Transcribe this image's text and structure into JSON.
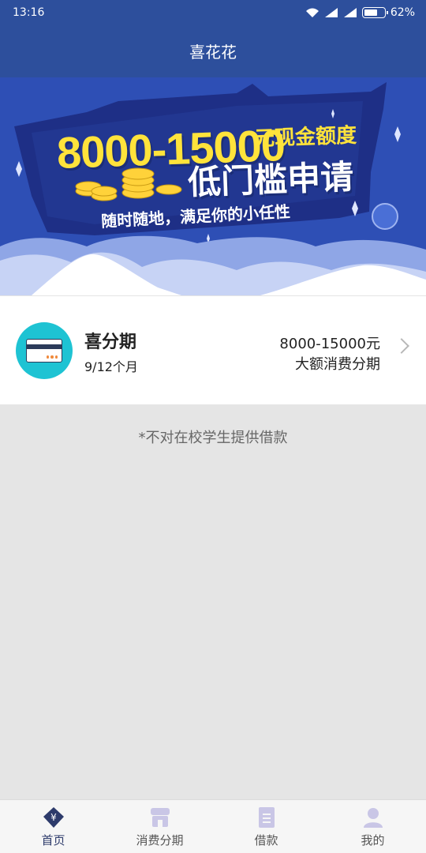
{
  "status": {
    "time": "13:16",
    "battery": "62%"
  },
  "appbar": {
    "title": "喜花花"
  },
  "banner": {
    "amount_text": "8000-15000",
    "unit_text": "元现金额度",
    "headline": "低门槛申请",
    "subline": "随时随地，满足你的小任性"
  },
  "product": {
    "name": "喜分期",
    "term": "9/12个月",
    "amount": "8000-15000元",
    "description": "大额消费分期"
  },
  "notice": "*不对在校学生提供借款",
  "tabs": [
    {
      "label": "首页",
      "icon": "yuan-shield-icon",
      "active": true
    },
    {
      "label": "消费分期",
      "icon": "shop-icon",
      "active": false
    },
    {
      "label": "借款",
      "icon": "bill-icon",
      "active": false
    },
    {
      "label": "我的",
      "icon": "user-icon",
      "active": false
    }
  ],
  "colors": {
    "primary": "#2d4f9c",
    "banner": "#2e4fb5",
    "accent_yellow": "#ffe33b",
    "icon_teal": "#1ec3d3",
    "tab_active": "#2d3b6b",
    "tab_inactive": "#c9c6e6"
  }
}
